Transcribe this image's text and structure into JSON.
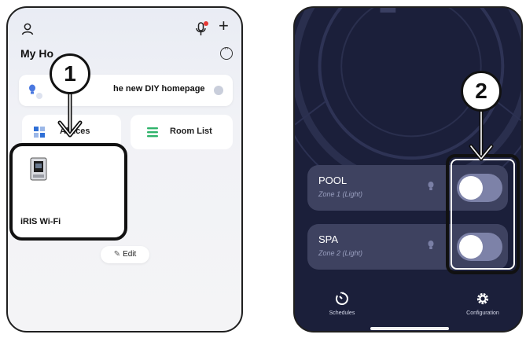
{
  "left_phone": {
    "header_title": "My Ho",
    "banner_text": "he new DIY homepage",
    "tiles": {
      "all_devices": "All    ices",
      "room_list": "Room List"
    },
    "device_card": {
      "name": "iRIS Wi-Fi"
    },
    "edit_label": "Edit"
  },
  "right_phone": {
    "zones": [
      {
        "name": "POOL",
        "subtitle": "Zone 1 (Light)",
        "switch_on": false
      },
      {
        "name": "SPA",
        "subtitle": "Zone 2 (Light)",
        "switch_on": false
      }
    ],
    "nav": {
      "schedules": "Schedules",
      "configuration": "Configuration"
    }
  },
  "callouts": {
    "step1": "1",
    "step2": "2"
  },
  "colors": {
    "right_bg": "#1b1f3a",
    "zone_card": "#3e4260",
    "switch_track": "#7d82a8",
    "mic_dot": "#e53935",
    "bulb_blue": "#4a78e0"
  },
  "icons": {
    "avatar": "person-icon",
    "mic": "microphone-icon",
    "add": "plus-icon",
    "more": "more-dots-icon",
    "bulb": "light-bulb-icon",
    "devices": "grid-icon",
    "rooms": "list-icon",
    "edit": "pencil-icon",
    "schedules": "timer-icon",
    "configuration": "gear-icon"
  }
}
